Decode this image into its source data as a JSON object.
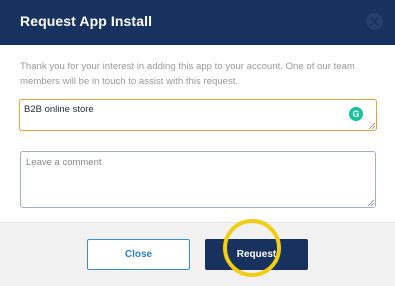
{
  "dialog": {
    "title": "Request App Install",
    "description": "Thank you for your interest in adding this app to your account. One of our team members will be in touch to assist with this request."
  },
  "form": {
    "store_value": "B2B online store",
    "grammarly_badge": "G",
    "comment_placeholder": "Leave a comment"
  },
  "footer": {
    "close_label": "Close",
    "request_label": "Request"
  },
  "colors": {
    "header": "#17325f",
    "focus_border": "#e8a23a",
    "close_button_border": "#3a8ed6",
    "highlight": "#f2cd13"
  }
}
